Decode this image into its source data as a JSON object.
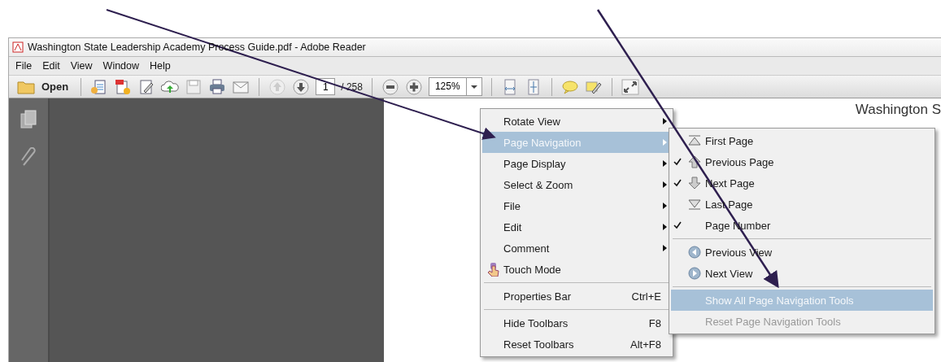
{
  "window": {
    "title": "Washington State Leadership Academy Process Guide.pdf - Adobe Reader"
  },
  "menu_bar": [
    "File",
    "Edit",
    "View",
    "Window",
    "Help"
  ],
  "toolbar": {
    "open": "Open",
    "page_number": "1",
    "page_count": "/ 258",
    "zoom": "125%"
  },
  "document": {
    "heading": "Washington S"
  },
  "context_menu": {
    "groups": [
      [
        {
          "label": "Rotate View",
          "kind": "submenu",
          "selected": false
        },
        {
          "label": "Page Navigation",
          "kind": "submenu",
          "selected": true
        },
        {
          "label": "Page Display",
          "kind": "submenu",
          "selected": false
        },
        {
          "label": "Select & Zoom",
          "kind": "submenu",
          "selected": false
        },
        {
          "label": "File",
          "kind": "submenu",
          "selected": false
        },
        {
          "label": "Edit",
          "kind": "submenu",
          "selected": false
        },
        {
          "label": "Comment",
          "kind": "submenu",
          "selected": false
        },
        {
          "label": "Touch Mode",
          "kind": "touch",
          "selected": false
        }
      ],
      [
        {
          "label": "Properties Bar",
          "kind": "shortcut",
          "shortcut": "Ctrl+E",
          "selected": false
        }
      ],
      [
        {
          "label": "Hide Toolbars",
          "kind": "shortcut",
          "shortcut": "F8",
          "selected": false
        },
        {
          "label": "Reset Toolbars",
          "kind": "shortcut",
          "shortcut": "Alt+F8",
          "selected": false
        }
      ]
    ]
  },
  "submenu": {
    "groups": [
      [
        {
          "label": "First Page",
          "kind": "first",
          "checked": false,
          "selected": false,
          "disabled": false
        },
        {
          "label": "Previous Page",
          "kind": "previous",
          "checked": true,
          "selected": false,
          "disabled": false
        },
        {
          "label": "Next Page",
          "kind": "next",
          "checked": true,
          "selected": false,
          "disabled": false
        },
        {
          "label": "Last Page",
          "kind": "last",
          "checked": false,
          "selected": false,
          "disabled": false
        },
        {
          "label": "Page Number",
          "kind": "none",
          "checked": true,
          "selected": false,
          "disabled": false
        }
      ],
      [
        {
          "label": "Previous View",
          "kind": "back",
          "checked": false,
          "selected": false,
          "disabled": false
        },
        {
          "label": "Next View",
          "kind": "forward",
          "checked": false,
          "selected": false,
          "disabled": false
        }
      ],
      [
        {
          "label": "Show All Page Navigation Tools",
          "kind": "none",
          "checked": false,
          "selected": true,
          "disabled": false
        },
        {
          "label": "Reset Page Navigation Tools",
          "kind": "none",
          "checked": false,
          "selected": false,
          "disabled": true
        }
      ]
    ]
  }
}
